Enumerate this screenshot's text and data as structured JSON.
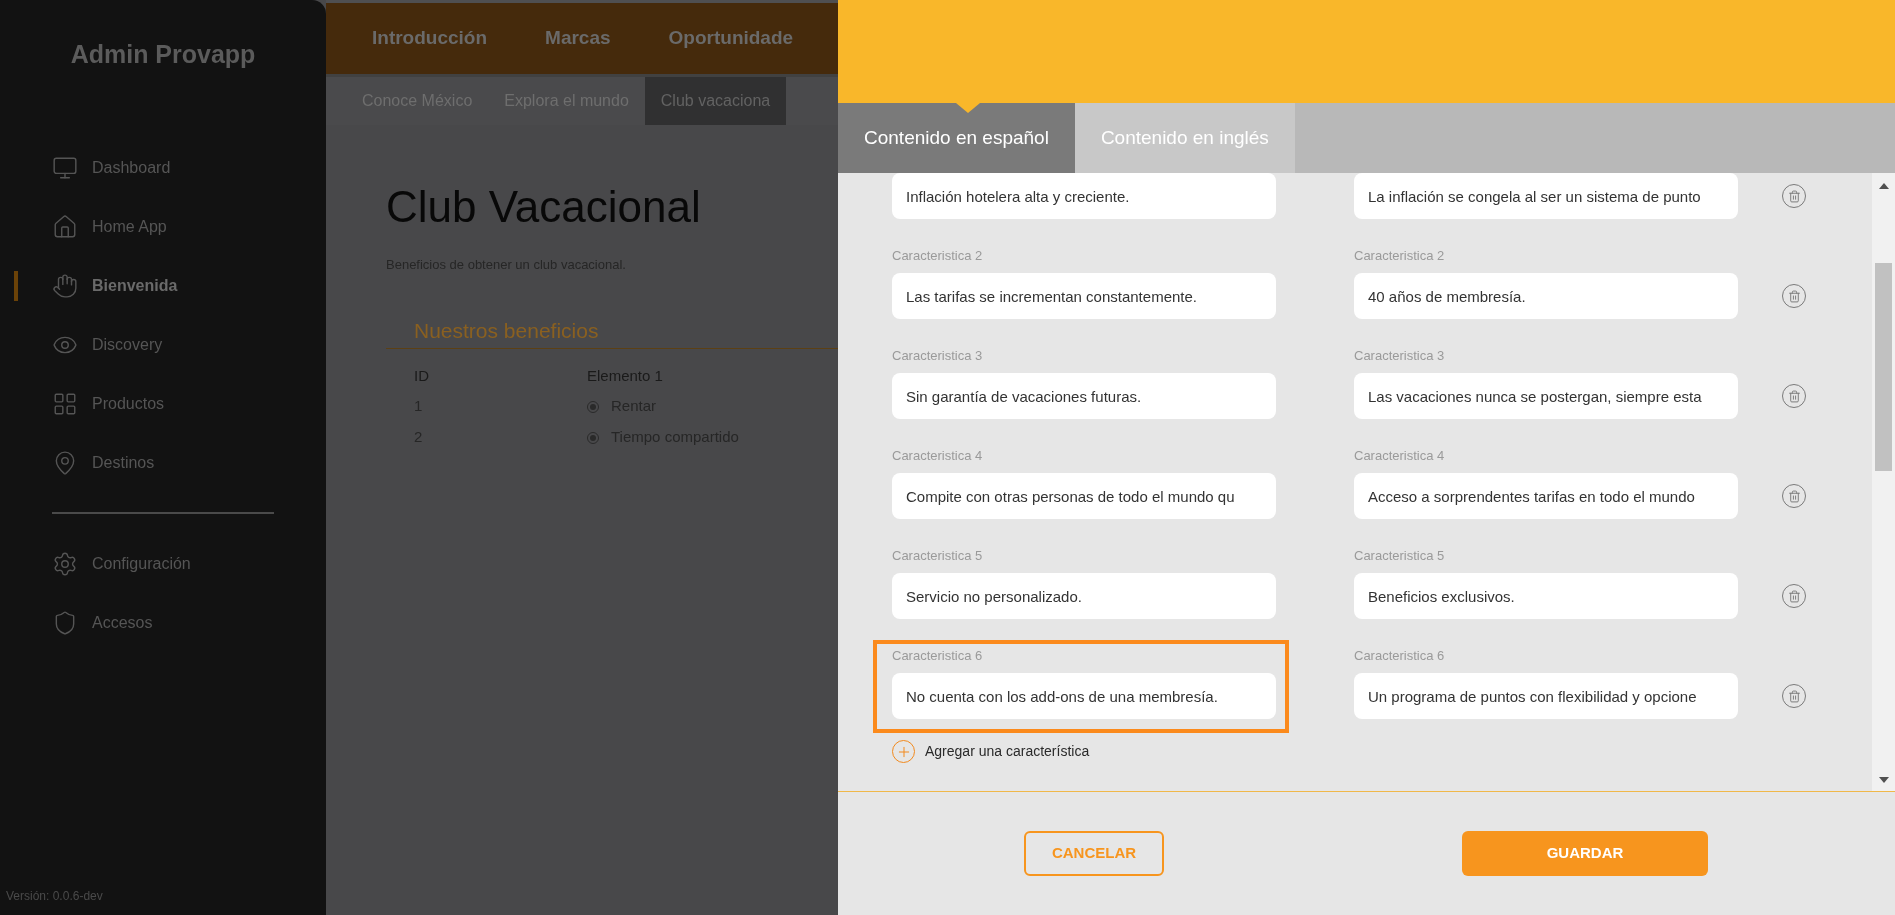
{
  "sidebar": {
    "title": "Admin Provapp",
    "items": [
      {
        "label": "Dashboard",
        "selected": false
      },
      {
        "label": "Home App",
        "selected": false
      },
      {
        "label": "Bienvenida",
        "selected": true
      },
      {
        "label": "Discovery",
        "selected": false
      },
      {
        "label": "Productos",
        "selected": false
      },
      {
        "label": "Destinos",
        "selected": false
      }
    ],
    "settings_items": [
      {
        "label": "Configuración",
        "selected": false
      },
      {
        "label": "Accesos",
        "selected": false
      }
    ],
    "version": "Versión: 0.0.6-dev"
  },
  "background_page": {
    "nav": [
      "Introducción",
      "Marcas",
      "Oportunidade"
    ],
    "subnav": [
      {
        "label": "Conoce México",
        "selected": false
      },
      {
        "label": "Explora el mundo",
        "selected": false
      },
      {
        "label": "Club vacaciona",
        "selected": true
      }
    ],
    "title": "Club Vacacional",
    "subtitle": "Beneficios de obtener un club vacacional.",
    "section_title": "Nuestros beneficios",
    "table": {
      "columns": [
        "ID",
        "Elemento 1"
      ],
      "rows": [
        [
          "1",
          "Rentar"
        ],
        [
          "2",
          "Tiempo compartido"
        ]
      ]
    }
  },
  "modal": {
    "tabs": [
      {
        "label": "Contenido en español",
        "selected": true
      },
      {
        "label": "Contenido en inglés",
        "selected": false
      }
    ],
    "rows": [
      {
        "left_value": "Inflación hotelera alta y creciente.",
        "right_value": "La inflación se congela al ser un sistema de punto",
        "highlighted": false
      },
      {
        "left_label": "Caracteristica 2",
        "left_value": "Las tarifas se incrementan constantemente.",
        "right_label": "Caracteristica 2",
        "right_value": "40 años de membresía.",
        "highlighted": false
      },
      {
        "left_label": "Caracteristica 3",
        "left_value": "Sin garantía de vacaciones futuras.",
        "right_label": "Caracteristica 3",
        "right_value": "Las vacaciones nunca se postergan, siempre esta",
        "highlighted": false
      },
      {
        "left_label": "Caracteristica 4",
        "left_value": "Compite con otras personas de todo el mundo qu",
        "right_label": "Caracteristica 4",
        "right_value": "Acceso a sorprendentes tarifas en todo el mundo",
        "highlighted": false
      },
      {
        "left_label": "Caracteristica 5",
        "left_value": "Servicio no personalizado.",
        "right_label": "Caracteristica 5",
        "right_value": "Beneficios exclusivos.",
        "highlighted": false
      },
      {
        "left_label": "Caracteristica 6",
        "left_value": "No cuenta con los add-ons de una membresía.",
        "right_label": "Caracteristica 6",
        "right_value": "Un programa de puntos con flexibilidad y opcione",
        "highlighted": true
      }
    ],
    "add_link": "Agregar una característica",
    "buttons": {
      "cancel": "CANCELAR",
      "save": "GUARDAR"
    }
  }
}
